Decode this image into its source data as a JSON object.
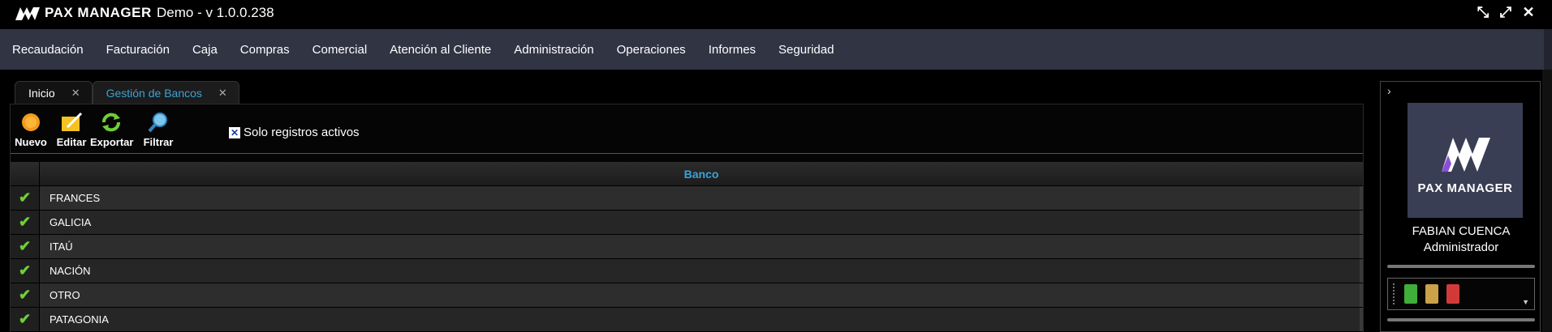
{
  "app": {
    "brand": "PAX MANAGER",
    "title": "Demo - v 1.0.0.238"
  },
  "window_controls": [
    "collapse-icon",
    "expand-icon",
    "close-icon"
  ],
  "menu": [
    "Recaudación",
    "Facturación",
    "Caja",
    "Compras",
    "Comercial",
    "Atención al Cliente",
    "Administración",
    "Operaciones",
    "Informes",
    "Seguridad"
  ],
  "tabs": [
    {
      "label": "Inicio",
      "active": false
    },
    {
      "label": "Gestión de Bancos",
      "active": true
    }
  ],
  "toolbar": {
    "nuevo": "Nuevo",
    "editar": "Editar",
    "exportar": "Exportar",
    "filtrar": "Filtrar",
    "solo_activos": "Solo registros activos",
    "solo_activos_checked": true
  },
  "grid": {
    "header": "Banco",
    "rows": [
      "FRANCES",
      "GALICIA",
      "ITAÚ",
      "NACIÓN",
      "OTRO",
      "PATAGONIA"
    ]
  },
  "sidebar": {
    "brand": "PAX MANAGER",
    "user_name": "FABIAN CUENCA",
    "user_role": "Administrador",
    "doc_colors": [
      "#3fae3a",
      "#c9a24a",
      "#d23a3a"
    ]
  },
  "colors": {
    "menu_bg": "#303443",
    "accent": "#3aa3d8",
    "check": "#6fce3a"
  }
}
